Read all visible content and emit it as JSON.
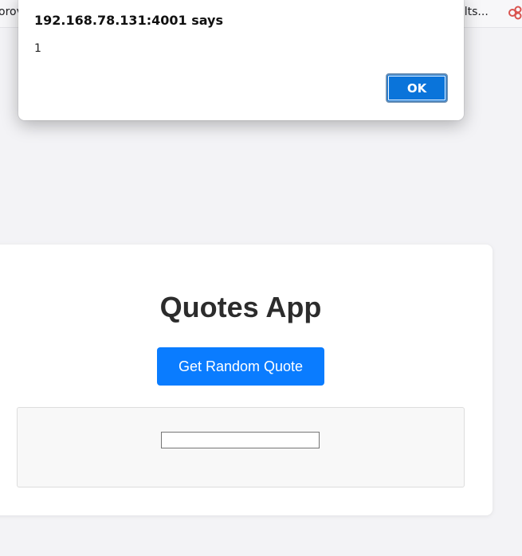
{
  "bookmarks": {
    "left_label": "orov",
    "right_label": "Ielts..."
  },
  "dialog": {
    "title": "192.168.78.131:4001 says",
    "message": "1",
    "ok_label": "OK"
  },
  "app": {
    "title": "Quotes App",
    "button_label": "Get Random Quote",
    "quote_value": ""
  },
  "colors": {
    "accent": "#0a7cff",
    "dialog_ok": "#0a74da",
    "page_bg": "#f3f3f6"
  }
}
